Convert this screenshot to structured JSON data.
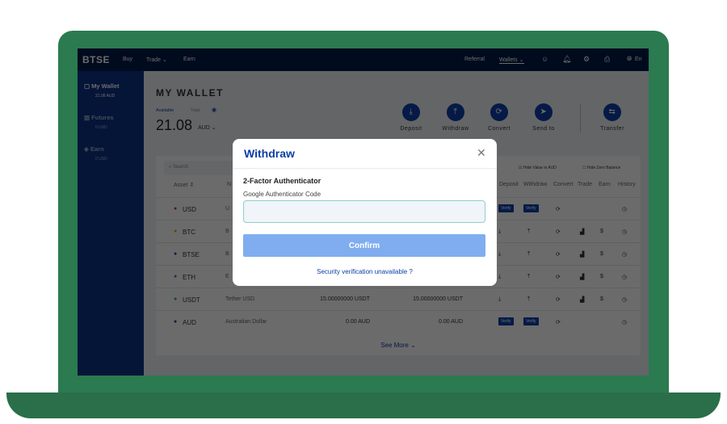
{
  "nav": {
    "logo": "BTSE",
    "buy": "Buy",
    "trade": "Trade ⌄",
    "earn": "Earn",
    "referral": "Referral",
    "wallets": "Wallets ⌄",
    "lang": "En"
  },
  "sidebar": [
    {
      "label": "My Wallet",
      "value": "21.08 AUD"
    },
    {
      "label": "Futures",
      "value": "0 USD"
    },
    {
      "label": "Earn",
      "value": "0 USD"
    }
  ],
  "wallet": {
    "title": "MY WALLET",
    "available": "Available",
    "total": "Total",
    "balance": "21.08",
    "currency": "AUD ⌄"
  },
  "actions": [
    {
      "label": "Deposit",
      "icon": "⤓"
    },
    {
      "label": "Withdraw",
      "icon": "⤒"
    },
    {
      "label": "Convert",
      "icon": "⟳"
    },
    {
      "label": "Send to",
      "icon": "➤"
    },
    {
      "label": "Transfer",
      "icon": "⇆"
    }
  ],
  "table": {
    "search": "Search",
    "hide_value": "Hide Value in AUD",
    "hide_zero": "Hide Zero Balance",
    "headers": [
      "Asset ⇕",
      "N",
      "Deposit",
      "Withdraw",
      "Convert",
      "Trade",
      "Earn",
      "History"
    ],
    "rows": [
      {
        "asset": "USD",
        "name": "U",
        "amount": "",
        "avail": "",
        "verify": true,
        "color": "#c0392b"
      },
      {
        "asset": "BTC",
        "name": "B",
        "amount": "",
        "avail": "",
        "verify": false,
        "color": "#f29b1d"
      },
      {
        "asset": "BTSE",
        "name": "B",
        "amount": "",
        "avail": "",
        "verify": false,
        "color": "#0b3ea6"
      },
      {
        "asset": "ETH",
        "name": "E",
        "amount": "",
        "avail": "",
        "verify": false,
        "color": "#5566cc"
      },
      {
        "asset": "USDT",
        "name": "Tether USD",
        "amount": "15.00000000 USDT",
        "avail": "15.00000000 USDT",
        "verify": false,
        "color": "#26a17b"
      },
      {
        "asset": "AUD",
        "name": "Australian Dollar",
        "amount": "0.00 AUD",
        "avail": "0.00 AUD",
        "verify": true,
        "color": "#1e3a8a"
      }
    ],
    "verify_label": "Verify",
    "see_more": "See More ⌄"
  },
  "modal": {
    "title": "Withdraw",
    "section": "2-Factor Authenticator",
    "field_label": "Google Authenticator Code",
    "field_value": "",
    "confirm": "Confirm",
    "link": "Security verification unavailable ?"
  },
  "colors": {
    "laptop": "#2b7a50",
    "nav": "#021a48",
    "accent": "#0b3ea6",
    "confirm": "#80adf0"
  }
}
